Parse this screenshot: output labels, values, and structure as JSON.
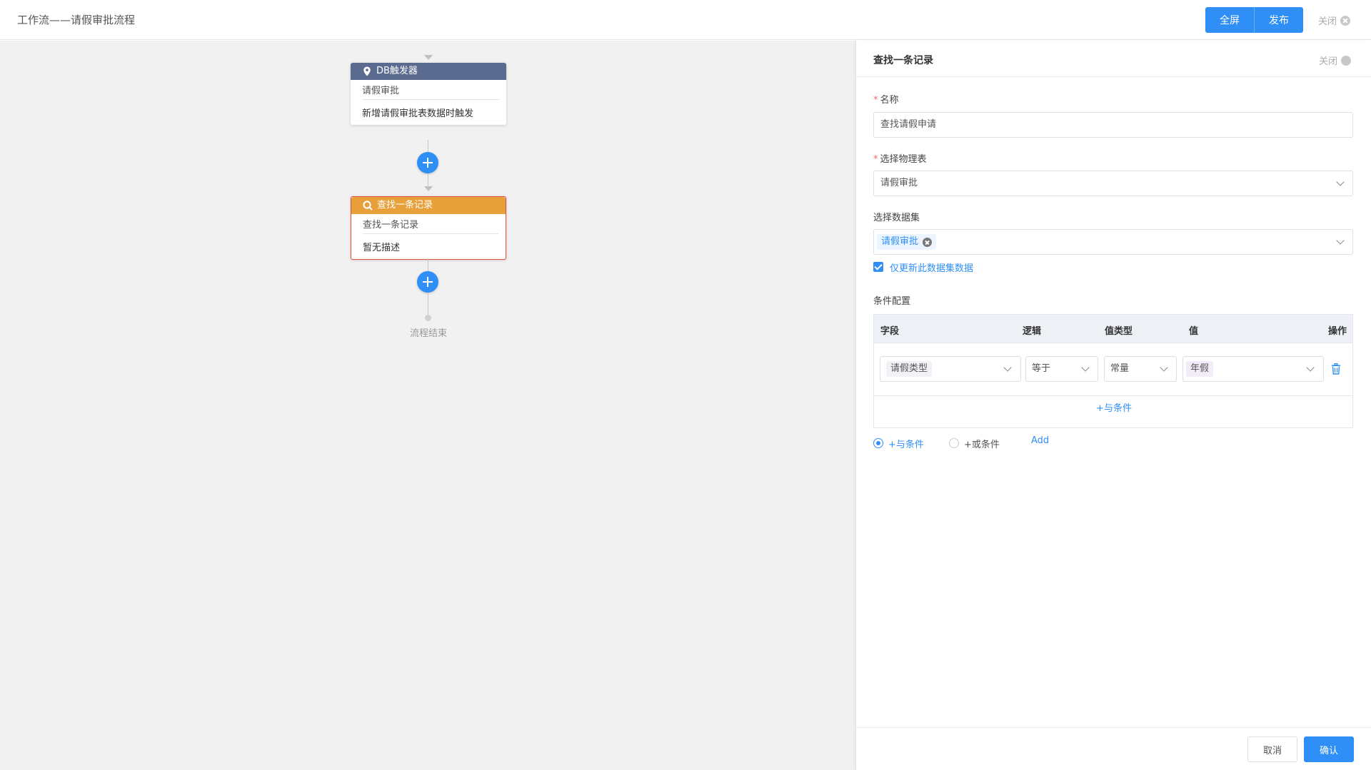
{
  "header": {
    "title": "工作流——请假审批流程",
    "fullscreen_label": "全屏",
    "publish_label": "发布",
    "close_label": "关闭"
  },
  "flow": {
    "trigger_node": {
      "title": "DB触发器",
      "subtitle": "请假审批",
      "description": "新增请假审批表数据时触发",
      "head_color": "#5a6b8f",
      "icon": "location-pin-icon"
    },
    "find_node": {
      "title": "查找一条记录",
      "subtitle": "查找一条记录",
      "description": "暂无描述",
      "head_color": "#e8a13a",
      "border_color": "#e04d3b",
      "icon": "search-icon"
    },
    "end_label": "流程结束"
  },
  "panel": {
    "title": "查找一条记录",
    "close_label": "关闭",
    "name_label": "名称",
    "name_value": "查找请假申请",
    "table_label": "选择物理表",
    "table_value": "请假审批",
    "dataset_label": "选择数据集",
    "dataset_tag": "请假审批",
    "only_update_label": "仅更新此数据集数据",
    "only_update_checked": true,
    "condition_label": "条件配置",
    "columns": [
      "字段",
      "逻辑",
      "值类型",
      "值",
      "操作"
    ],
    "row": {
      "field": "请假类型",
      "logic": "等于",
      "value_type": "常量",
      "value": "年假"
    },
    "and_condition_link": "+与条件",
    "radio_and_label": "+与条件",
    "radio_or_label": "+或条件",
    "radio_selected": "and",
    "add_label": "Add",
    "cancel_label": "取消",
    "confirm_label": "确认"
  },
  "colors": {
    "primary": "#2f8ff7",
    "required": "#f56c6c"
  }
}
